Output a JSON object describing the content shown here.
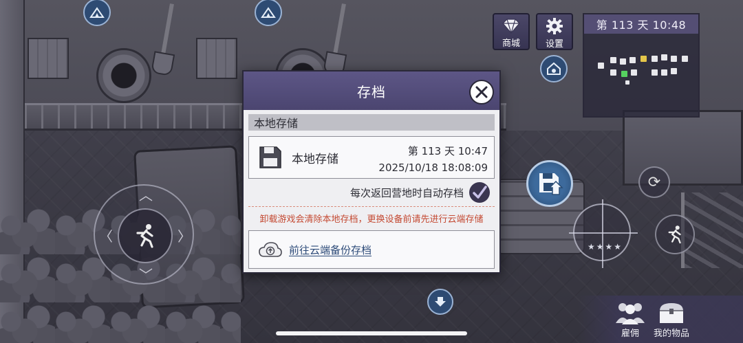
{
  "hud": {
    "shop_label": "商城",
    "settings_label": "设置",
    "day_time": "第 113 天  10:48",
    "hire_label": "雇佣",
    "my_items_label": "我的物品",
    "stars": "★★★★"
  },
  "dialog": {
    "title": "存档",
    "section_title": "本地存储",
    "slot": {
      "name": "本地存储",
      "day_time": "第 113 天  10:47",
      "date": "2025/10/18 18:08:09"
    },
    "auto_save_label": "每次返回营地时自动存档",
    "auto_save_checked": true,
    "warning": "卸载游戏会清除本地存档，更换设备前请先进行云端存储",
    "cloud_link": "前往云端备份存档"
  },
  "colors": {
    "dialog_header": "#4b4570",
    "warning": "#c44a33",
    "link": "#2c4a78"
  }
}
